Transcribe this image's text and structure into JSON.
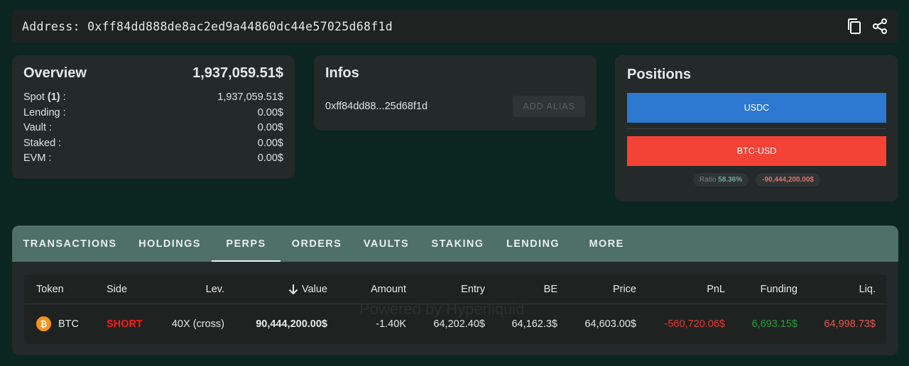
{
  "address_bar": {
    "label": "Address:",
    "address": "0xff84dd888de8ac2ed9a44860dc44e57025d68f1d",
    "copy_icon": "copy-icon",
    "share_icon": "share-icon"
  },
  "overview": {
    "title": "Overview",
    "total": "1,937,059.51$",
    "rows": [
      {
        "label": "Spot",
        "count": "(1)",
        "suffix": " :",
        "value": "1,937,059.51$"
      },
      {
        "label": "Lending :",
        "value": "0.00$"
      },
      {
        "label": "Vault :",
        "value": "0.00$"
      },
      {
        "label": "Staked :",
        "value": "0.00$"
      },
      {
        "label": "EVM :",
        "value": "0.00$"
      }
    ]
  },
  "infos": {
    "title": "Infos",
    "short_address": "0xff84dd88...25d68f1d",
    "add_alias_label": "ADD ALIAS"
  },
  "positions": {
    "title": "Positions",
    "usdc_label": "USDC",
    "btc_label": "BTC-USD",
    "ratio_label": "Ratio",
    "ratio_value": "58.36%",
    "net_value": "-90,444,200.00$",
    "colors": {
      "usdc": "#2d78d0",
      "btc": "#f44336"
    }
  },
  "tabs": [
    {
      "label": "TRANSACTIONS",
      "active": false
    },
    {
      "label": "HOLDINGS",
      "active": false
    },
    {
      "label": "PERPS",
      "active": true
    },
    {
      "label": "ORDERS",
      "active": false
    },
    {
      "label": "VAULTS",
      "active": false
    },
    {
      "label": "STAKING",
      "active": false
    },
    {
      "label": "LENDING",
      "active": false
    },
    {
      "label": "MORE",
      "active": false
    }
  ],
  "table": {
    "sort_icon": "arrow-down-icon",
    "headers": {
      "token": "Token",
      "side": "Side",
      "lev": "Lev.",
      "value": "Value",
      "amount": "Amount",
      "entry": "Entry",
      "be": "BE",
      "price": "Price",
      "pnl": "PnL",
      "funding": "Funding",
      "liq": "Liq."
    },
    "rows": [
      {
        "token": "BTC",
        "token_icon": "bitcoin-icon",
        "token_icon_glyph": "₿",
        "side": "SHORT",
        "lev": "40X (cross)",
        "value": "90,444,200.00$",
        "amount": "-1.40K",
        "entry": "64,202.40$",
        "be": "64,162.3$",
        "price": "64,603.00$",
        "pnl": "-560,720.06$",
        "funding": "6,693.15$",
        "liq": "64,998.73$"
      }
    ]
  },
  "watermark": "Powered by Hyperliquid"
}
